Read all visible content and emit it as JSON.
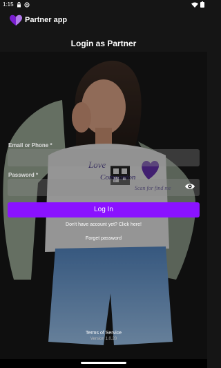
{
  "status_bar": {
    "time": "1:15"
  },
  "app_bar": {
    "title": "Partner app"
  },
  "page": {
    "title": "Login as Partner"
  },
  "hero": {
    "shirt_line1": "Love",
    "shirt_line2": "Companion",
    "shirt_line3": "Scan for find me"
  },
  "form": {
    "email_label": "Email or Phone *",
    "password_label": "Password *",
    "login_label": "Log In",
    "signup_text": "Don't have account yet? Click here!",
    "forgot_text": "Forget password"
  },
  "footer": {
    "terms": "Terms of Service",
    "version": "Version 1.0.20"
  },
  "colors": {
    "accent": "#8a12ff",
    "logo": "#7a1fd1",
    "background": "#151515"
  },
  "icons": [
    "lock-icon",
    "sync-icon",
    "wifi-icon",
    "battery-icon",
    "heart-logo-icon",
    "eye-icon"
  ]
}
